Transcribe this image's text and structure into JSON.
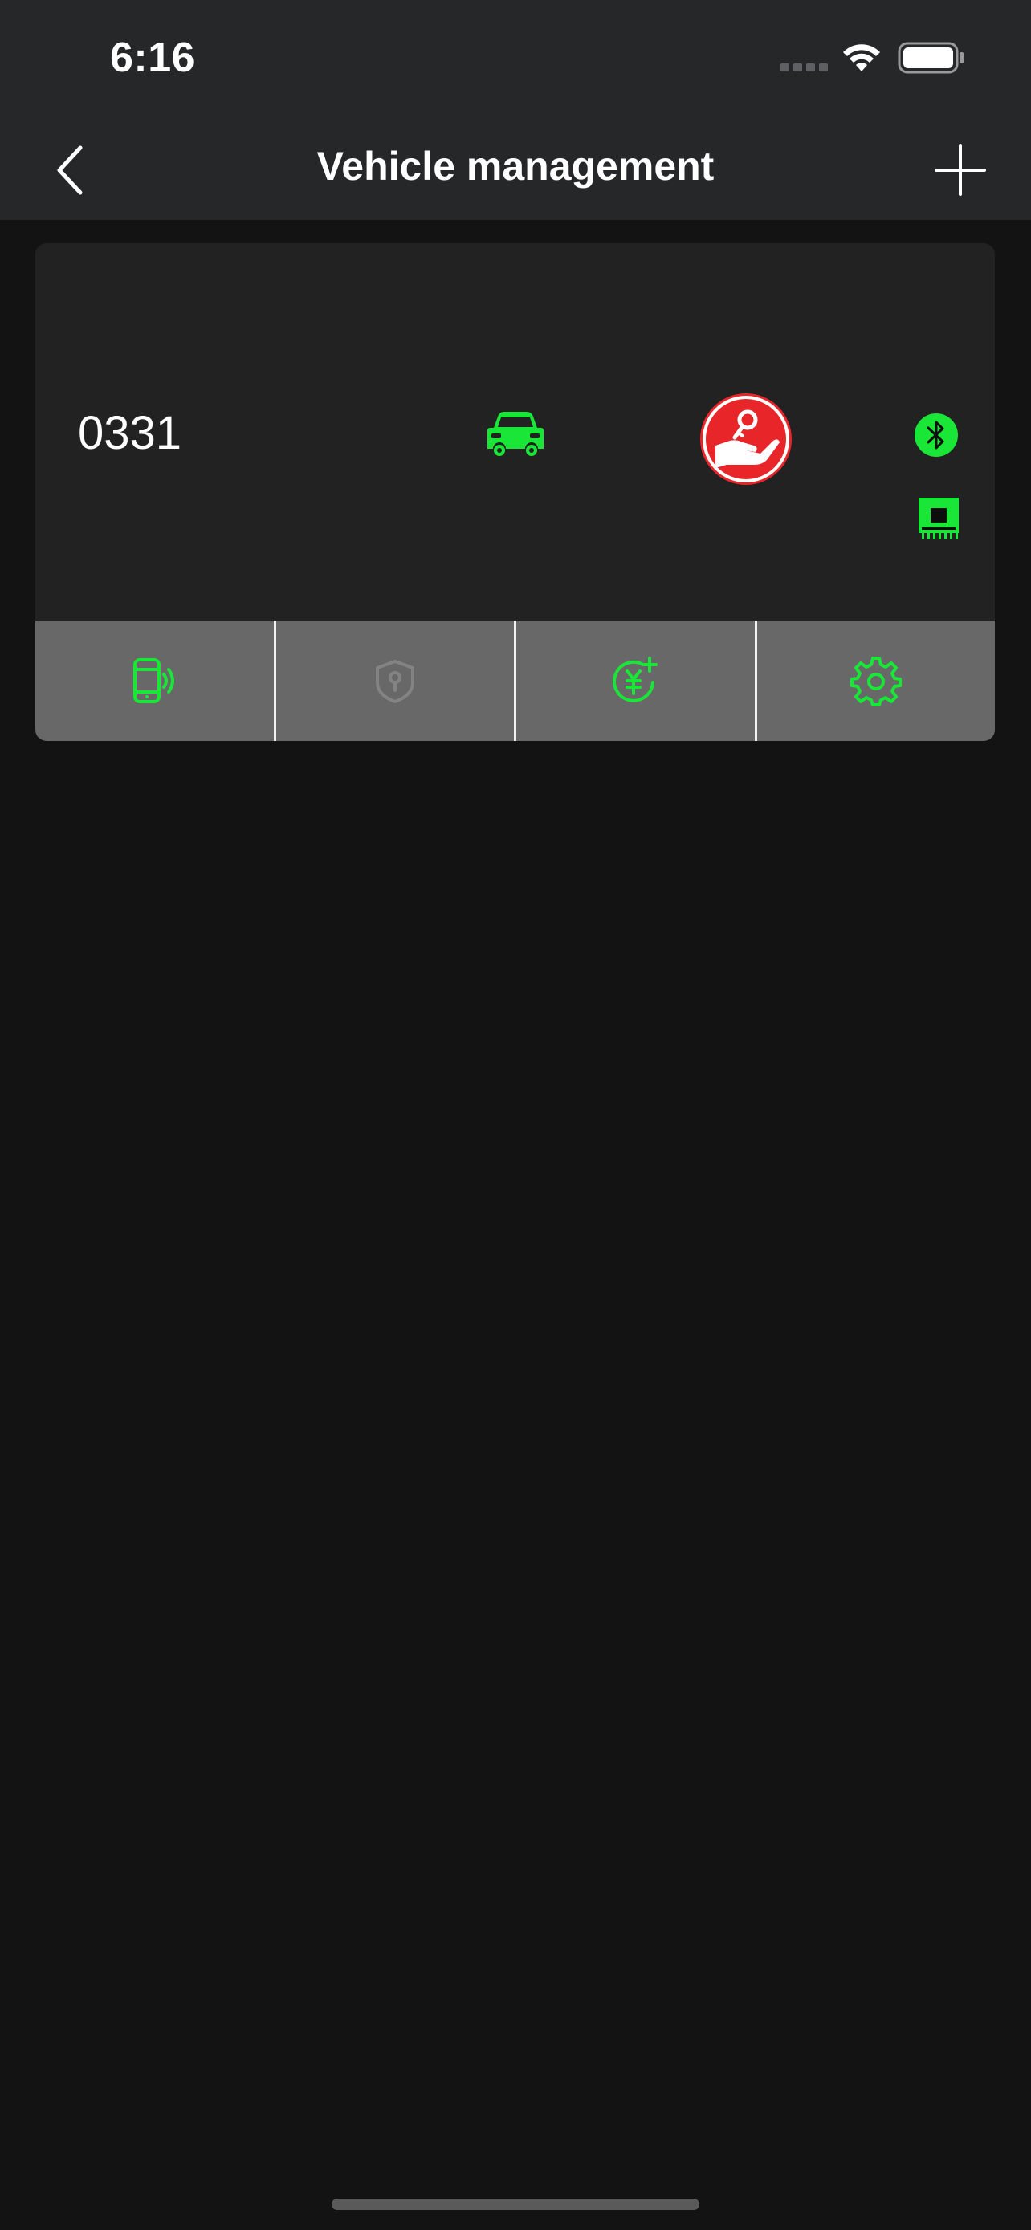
{
  "status_bar": {
    "time": "6:16",
    "icons": [
      "cellular-signal-icon",
      "wifi-icon",
      "battery-icon"
    ]
  },
  "nav": {
    "title": "Vehicle management",
    "back_icon": "chevron-left-icon",
    "add_icon": "plus-icon"
  },
  "vehicles": [
    {
      "name": "0331",
      "status_icons": [
        "car-icon",
        "key-in-hand-icon",
        "bluetooth-icon",
        "chip-module-icon"
      ],
      "actions": [
        {
          "icon": "phone-key-icon",
          "enabled": true
        },
        {
          "icon": "shield-key-icon",
          "enabled": false
        },
        {
          "icon": "yuan-recharge-icon",
          "enabled": true
        },
        {
          "icon": "gear-icon",
          "enabled": true
        }
      ]
    }
  ],
  "colors": {
    "accent_green": "#19e637",
    "alert_red": "#e8262a",
    "header_bg": "#262729",
    "page_bg": "#131313",
    "card_bg": "#222223",
    "action_bar_bg": "#686868"
  }
}
